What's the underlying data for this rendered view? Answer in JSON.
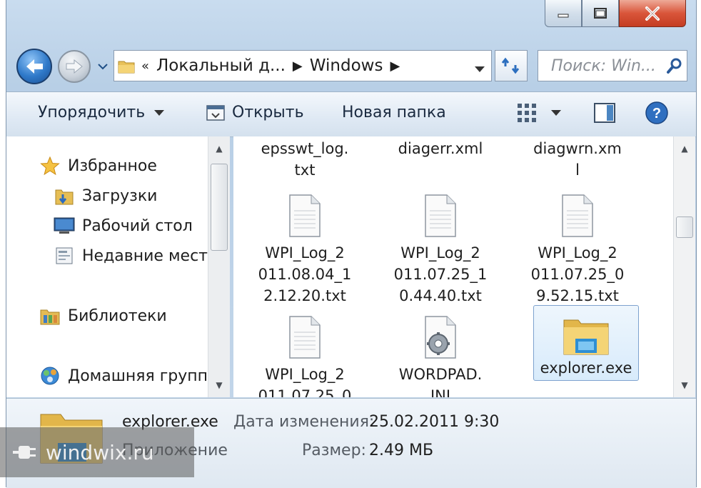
{
  "window": {
    "caption_buttons": [
      "minimize-icon",
      "maximize-icon",
      "close-icon"
    ]
  },
  "address_bar": {
    "prefix": "«",
    "segments": [
      "Локальный д...",
      "Windows"
    ],
    "separator": "▶"
  },
  "search": {
    "placeholder": "Поиск: Win..."
  },
  "toolbar": {
    "organize_label": "Упорядочить",
    "open_label": "Открыть",
    "new_folder_label": "Новая папка"
  },
  "nav_pane": {
    "favorites_label": "Избранное",
    "items": [
      {
        "label": "Загрузки",
        "icon": "downloads-folder-icon"
      },
      {
        "label": "Рабочий стол",
        "icon": "desktop-icon"
      },
      {
        "label": "Недавние мест",
        "icon": "recent-places-icon"
      }
    ],
    "libraries_label": "Библиотеки",
    "homegroup_label": "Домашняя групп"
  },
  "files": [
    {
      "name": "epsswt_log.\ntxt",
      "icon": "none"
    },
    {
      "name": "diagerr.xml",
      "icon": "none"
    },
    {
      "name": "diagwrn.xm\nl",
      "icon": "none"
    },
    {
      "name": "WPI_Log_2\n011.08.04_1\n2.12.20.txt",
      "icon": "text-file-icon"
    },
    {
      "name": "WPI_Log_2\n011.07.25_1\n0.44.40.txt",
      "icon": "text-file-icon"
    },
    {
      "name": "WPI_Log_2\n011.07.25_0\n9.52.15.txt",
      "icon": "text-file-icon"
    },
    {
      "name": "WPI_Log_2\n011.07.25_0",
      "icon": "text-file-icon"
    },
    {
      "name": "WORDPAD.\nINI",
      "icon": "settings-file-icon"
    },
    {
      "name": "explorer.exe",
      "icon": "explorer-app-icon",
      "selected": true
    }
  ],
  "details": {
    "name": "explorer.exe",
    "type": "Приложение",
    "modified_label": "Дата изменения:",
    "modified_value": "25.02.2011 9:30",
    "size_label": "Размер:",
    "size_value": "2.49 МБ"
  },
  "watermark": {
    "text": "windwix.ru"
  },
  "colors": {
    "chrome": "#c4d7ea",
    "selection": "#d8ebfb",
    "close_button": "#c43d22"
  }
}
